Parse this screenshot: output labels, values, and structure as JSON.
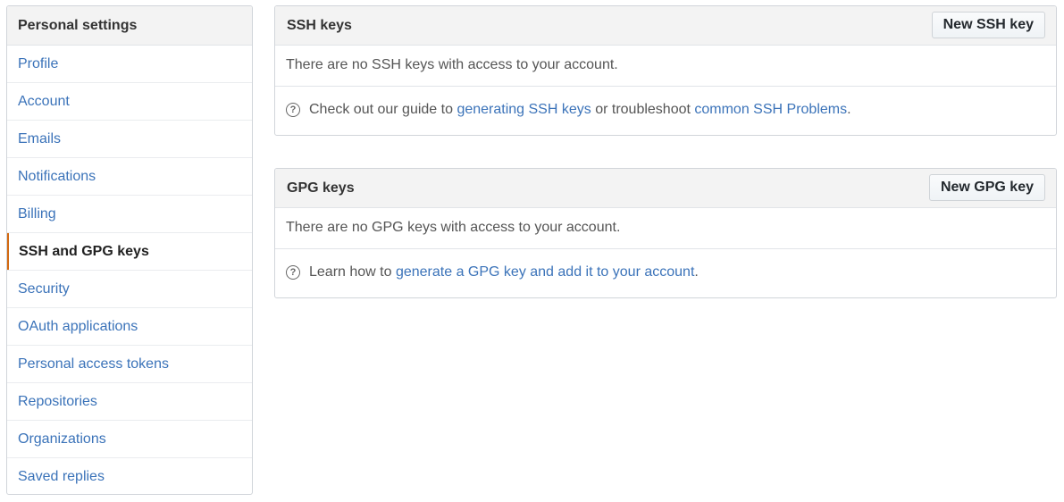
{
  "sidebar": {
    "header": "Personal settings",
    "items": [
      {
        "label": "Profile"
      },
      {
        "label": "Account"
      },
      {
        "label": "Emails"
      },
      {
        "label": "Notifications"
      },
      {
        "label": "Billing"
      },
      {
        "label": "SSH and GPG keys"
      },
      {
        "label": "Security"
      },
      {
        "label": "OAuth applications"
      },
      {
        "label": "Personal access tokens"
      },
      {
        "label": "Repositories"
      },
      {
        "label": "Organizations"
      },
      {
        "label": "Saved replies"
      }
    ],
    "selected_index": 5
  },
  "ssh": {
    "title": "SSH keys",
    "button": "New SSH key",
    "empty_text": "There are no SSH keys with access to your account.",
    "help_prefix": "Check out our guide to ",
    "help_link1": "generating SSH keys",
    "help_middle": " or troubleshoot ",
    "help_link2": "common SSH Problems",
    "help_suffix": "."
  },
  "gpg": {
    "title": "GPG keys",
    "button": "New GPG key",
    "empty_text": "There are no GPG keys with access to your account.",
    "help_prefix": "Learn how to ",
    "help_link": "generate a GPG key and add it to your account",
    "help_suffix": "."
  },
  "icons": {
    "help": "question-circle-icon"
  },
  "colors": {
    "link": "#3b73b9",
    "selected_accent": "#d26911",
    "header_bg": "#f3f3f3",
    "border": "#d1d5da"
  }
}
